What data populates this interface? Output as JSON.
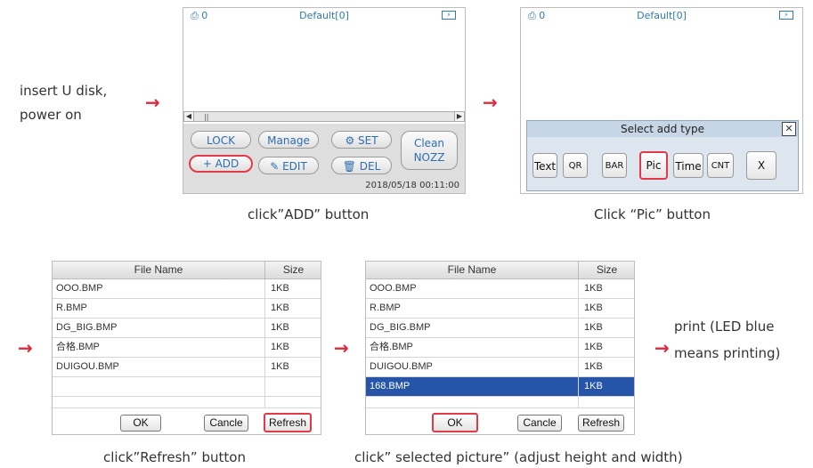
{
  "captions": {
    "insert": "insert U disk,",
    "power": "power on",
    "click_add": "click”ADD” button",
    "click_pic": "Click “Pic” button",
    "click_refresh": "click”Refresh” button",
    "click_selected": "click” selected picture” (adjust height and width)",
    "print1": "print (LED blue",
    "print2": "means printing)"
  },
  "arrow": "→",
  "screen1": {
    "printer_count": "0",
    "title": "Default[0]",
    "buttons": {
      "lock": "LOCK",
      "manage": "Manage",
      "set": "SET",
      "add": "ADD",
      "edit": "EDIT",
      "del": "DEL",
      "clean1": "Clean",
      "clean2": "NOZZ"
    },
    "datetime": "2018/05/18 00:11:00"
  },
  "screen2": {
    "printer_count": "0",
    "title": "Default[0]",
    "dialog_title": "Select add type",
    "types": [
      "Text",
      "QR",
      "BAR",
      "Pic",
      "Time",
      "CNT",
      "X"
    ]
  },
  "file_table_headers": {
    "name": "File Name",
    "size": "Size"
  },
  "file_list1": [
    {
      "name": "OOO.BMP",
      "size": "1KB"
    },
    {
      "name": "R.BMP",
      "size": "1KB"
    },
    {
      "name": "DG_BIG.BMP",
      "size": "1KB"
    },
    {
      "name": "合格.BMP",
      "size": "1KB"
    },
    {
      "name": "DUIGOU.BMP",
      "size": "1KB"
    },
    {
      "name": "",
      "size": ""
    },
    {
      "name": "",
      "size": ""
    }
  ],
  "file_list2": [
    {
      "name": "OOO.BMP",
      "size": "1KB"
    },
    {
      "name": "R.BMP",
      "size": "1KB"
    },
    {
      "name": "DG_BIG.BMP",
      "size": "1KB"
    },
    {
      "name": "合格.BMP",
      "size": "1KB"
    },
    {
      "name": "DUIGOU.BMP",
      "size": "1KB"
    },
    {
      "name": "168.BMP",
      "size": "1KB"
    },
    {
      "name": "",
      "size": ""
    }
  ],
  "file_buttons": {
    "ok": "OK",
    "cancle": "Cancle",
    "refresh": "Refresh"
  },
  "colors": {
    "highlight": "#e23a4a",
    "selected_row": "#2654a8",
    "arrow": "#e0283c"
  }
}
